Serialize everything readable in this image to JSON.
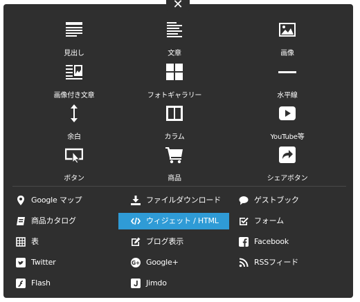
{
  "close": {
    "icon": "close-icon",
    "glyph": "✕"
  },
  "tiles": [
    {
      "label": "見出し",
      "icon": "heading-icon"
    },
    {
      "label": "文章",
      "icon": "text-icon"
    },
    {
      "label": "画像",
      "icon": "image-icon"
    },
    {
      "label": "画像付き文章",
      "icon": "image-text-icon"
    },
    {
      "label": "フォトギャラリー",
      "icon": "photo-gallery-icon"
    },
    {
      "label": "水平線",
      "icon": "horizontal-line-icon"
    },
    {
      "label": "余白",
      "icon": "spacer-icon"
    },
    {
      "label": "カラム",
      "icon": "columns-icon"
    },
    {
      "label": "YouTube等",
      "icon": "youtube-icon"
    },
    {
      "label": "ボタン",
      "icon": "button-icon"
    },
    {
      "label": "商品",
      "icon": "cart-icon"
    },
    {
      "label": "シェアボタン",
      "icon": "share-icon"
    }
  ],
  "list": [
    {
      "label": "Google マップ",
      "icon": "map-pin-icon"
    },
    {
      "label": "ファイルダウンロード",
      "icon": "download-icon"
    },
    {
      "label": "ゲストブック",
      "icon": "guestbook-icon"
    },
    {
      "label": "商品カタログ",
      "icon": "catalog-icon"
    },
    {
      "label": "ウィジェット / HTML",
      "icon": "code-icon",
      "active": true
    },
    {
      "label": "フォーム",
      "icon": "form-icon"
    },
    {
      "label": "表",
      "icon": "table-icon"
    },
    {
      "label": "ブログ表示",
      "icon": "blog-icon"
    },
    {
      "label": "Facebook",
      "icon": "facebook-icon"
    },
    {
      "label": "Twitter",
      "icon": "twitter-icon"
    },
    {
      "label": "Google+",
      "icon": "googleplus-icon"
    },
    {
      "label": "RSSフィード",
      "icon": "rss-icon"
    },
    {
      "label": "Flash",
      "icon": "flash-icon"
    },
    {
      "label": "Jimdo",
      "icon": "jimdo-icon"
    }
  ],
  "colors": {
    "panel": "#2f2f2f",
    "active": "#2f9bd6",
    "text": "#ffffff"
  }
}
